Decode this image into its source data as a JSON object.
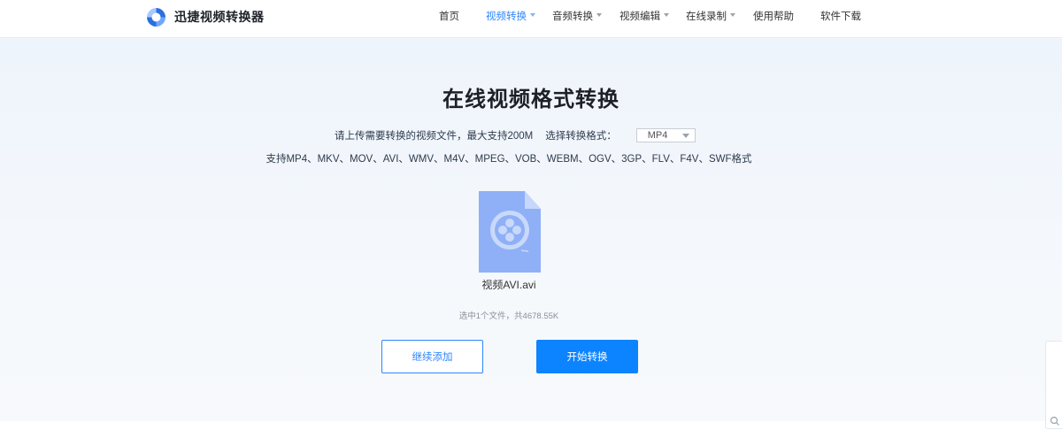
{
  "header": {
    "logo_text": "迅捷视频转换器",
    "nav": [
      {
        "label": "首页",
        "has_dropdown": false,
        "active": false
      },
      {
        "label": "视频转换",
        "has_dropdown": true,
        "active": true
      },
      {
        "label": "音频转换",
        "has_dropdown": true,
        "active": false
      },
      {
        "label": "视频编辑",
        "has_dropdown": true,
        "active": false
      },
      {
        "label": "在线录制",
        "has_dropdown": true,
        "active": false
      },
      {
        "label": "使用帮助",
        "has_dropdown": false,
        "active": false
      },
      {
        "label": "软件下载",
        "has_dropdown": false,
        "active": false
      }
    ]
  },
  "main": {
    "title": "在线视频格式转换",
    "upload_hint": "请上传需要转换的视频文件，最大支持200M",
    "format_label": "选择转换格式：",
    "selected_format": "MP4",
    "supported_formats": "支持MP4、MKV、MOV、AVI、WMV、M4V、MPEG、VOB、WEBM、OGV、3GP、FLV、F4V、SWF格式",
    "file": {
      "name": "视频AVI.avi",
      "icon": "video-file-icon"
    },
    "summary": "选中1个文件，共4678.55K",
    "buttons": {
      "add_label": "继续添加",
      "start_label": "开始转换"
    }
  },
  "colors": {
    "accent": "#2c86ff",
    "primary_button": "#0d84ff",
    "file_icon": "#8fb0f7"
  }
}
